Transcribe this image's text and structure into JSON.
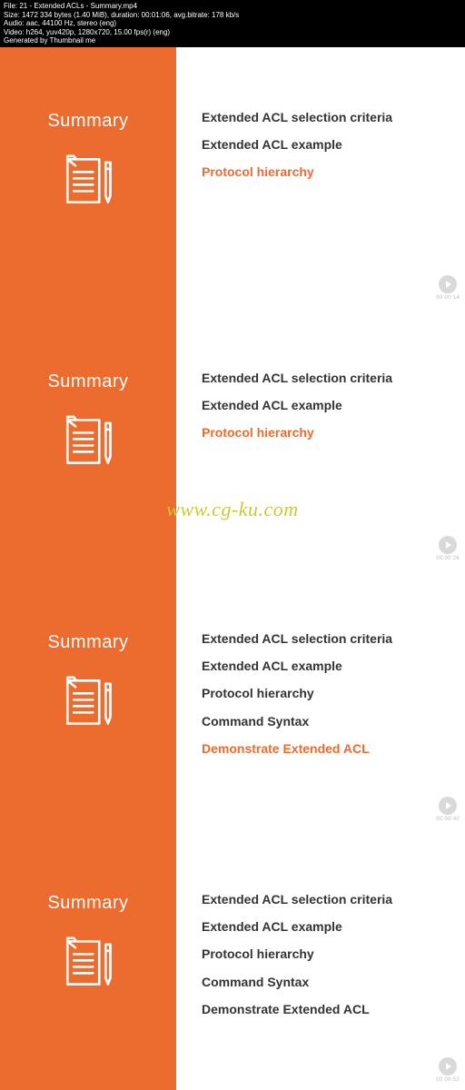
{
  "header": {
    "file": "File: 21 - Extended ACLs - Summary.mp4",
    "size": "Size: 1472 334 bytes (1.40 MiB), duration: 00:01:06, avg.bitrate: 178 kb/s",
    "audio": "Audio: aac, 44100 Hz, stereo (eng)",
    "video": "Video: h264, yuv420p, 1280x720, 15.00 fps(r) (eng)",
    "generated": "Generated by Thumbnail me"
  },
  "watermark": "www.cg-ku.com",
  "frames": [
    {
      "title": "Summary",
      "lines": [
        {
          "text": "Extended ACL selection criteria",
          "hl": false
        },
        {
          "text": "Extended ACL example",
          "hl": false
        },
        {
          "text": "Protocol hierarchy",
          "hl": true
        }
      ],
      "timestamp": "00:00:14"
    },
    {
      "title": "Summary",
      "lines": [
        {
          "text": "Extended ACL selection criteria",
          "hl": false
        },
        {
          "text": "Extended ACL example",
          "hl": false
        },
        {
          "text": "Protocol hierarchy",
          "hl": true
        }
      ],
      "timestamp": "00:00:26"
    },
    {
      "title": "Summary",
      "lines": [
        {
          "text": "Extended ACL selection criteria",
          "hl": false
        },
        {
          "text": "Extended ACL example",
          "hl": false
        },
        {
          "text": "Protocol hierarchy",
          "hl": false
        },
        {
          "text": "Command Syntax",
          "hl": false
        },
        {
          "text": "Demonstrate Extended ACL",
          "hl": true
        }
      ],
      "timestamp": "00:00:40"
    },
    {
      "title": "Summary",
      "lines": [
        {
          "text": "Extended ACL selection criteria",
          "hl": false
        },
        {
          "text": "Extended ACL example",
          "hl": false
        },
        {
          "text": "Protocol hierarchy",
          "hl": false
        },
        {
          "text": "Command Syntax",
          "hl": false
        },
        {
          "text": "Demonstrate Extended ACL",
          "hl": false
        }
      ],
      "timestamp": "00:00:52"
    }
  ]
}
